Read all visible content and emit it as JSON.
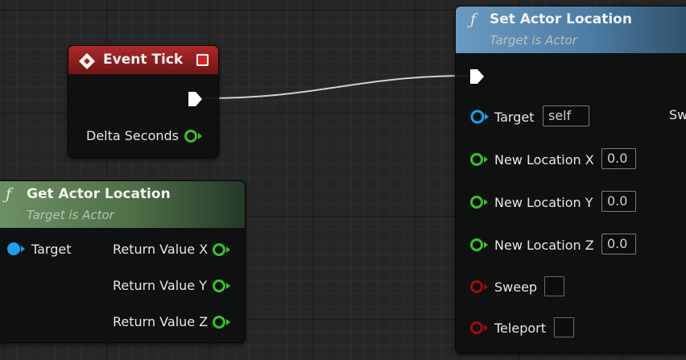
{
  "colors": {
    "exec_pin": "#ffffff",
    "float_pin": "#39c12a",
    "object_pin": "#1aa0f0",
    "bool_pin": "#a10b0b",
    "event_header": "#a02424",
    "pure_function_header": "#5e8656",
    "function_header": "#5a8cb5",
    "wire": "#d0d0d0"
  },
  "icons": {
    "event": "diamond-event-icon",
    "function": "function-f-icon",
    "delegate": "red-delegate-square-icon"
  },
  "event_tick": {
    "title": "Event Tick",
    "pins": {
      "delta_seconds": "Delta Seconds"
    }
  },
  "get_actor_location": {
    "title": "Get Actor Location",
    "subtitle": "Target is Actor",
    "pins": {
      "target": "Target",
      "return_x": "Return Value X",
      "return_y": "Return Value Y",
      "return_z": "Return Value Z"
    }
  },
  "set_actor_location": {
    "title": "Set Actor Location",
    "subtitle": "Target is Actor",
    "pins": {
      "target": "Target",
      "target_value": "self",
      "new_x": "New Location X",
      "new_x_value": "0.0",
      "new_y": "New Location Y",
      "new_y_value": "0.0",
      "new_z": "New Location Z",
      "new_z_value": "0.0",
      "sweep": "Sweep",
      "teleport": "Teleport",
      "cutoff_label": "Sw"
    },
    "func_glyph": "f"
  }
}
